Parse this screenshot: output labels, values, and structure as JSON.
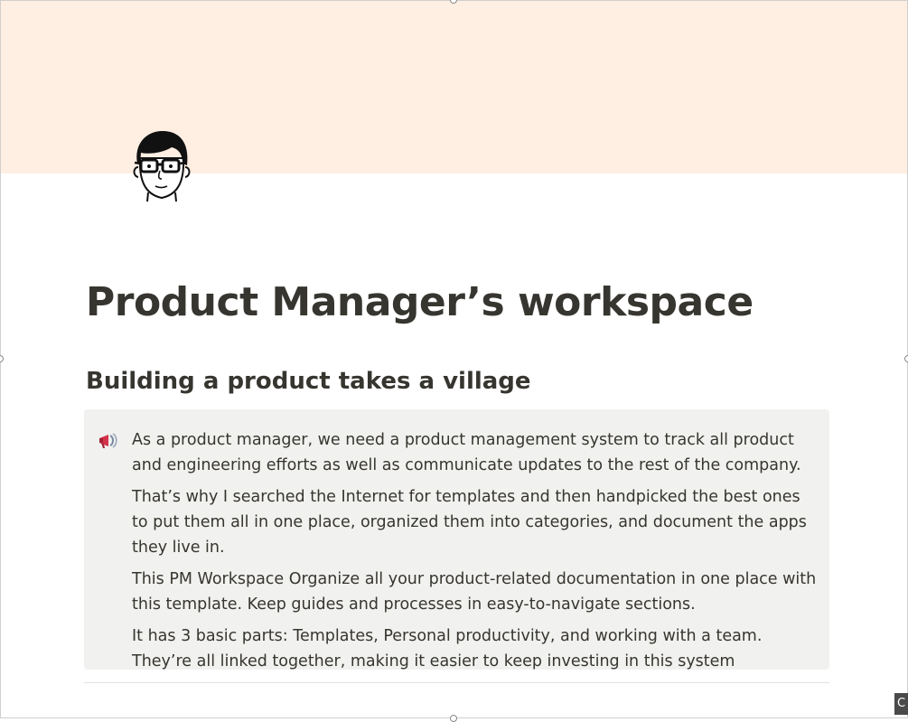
{
  "page": {
    "cover_color": "#ffeee2",
    "icon": "man-with-glasses-avatar-icon",
    "title": "Product Manager’s workspace"
  },
  "section": {
    "heading": "Building a product takes a village"
  },
  "callout": {
    "icon": "megaphone-icon",
    "background": "#f1f1ef",
    "paragraphs": [
      "As a product manager, we need a product management system to track all product and engineering efforts as well as communicate updates to the rest of the company.",
      "That’s why I searched the Internet for templates and then handpicked the best ones to put them all in one place, organized them into categories, and document the apps they live in.",
      "This PM Workspace Organize all your product-related documentation in one place with this template. Keep guides and processes in easy-to-navigate sections.",
      "It has 3 basic parts: Templates, Personal productivity, and working with a team. They’re all linked together, making it easier to keep investing in this system"
    ]
  },
  "corner_chip": {
    "label": "C"
  }
}
